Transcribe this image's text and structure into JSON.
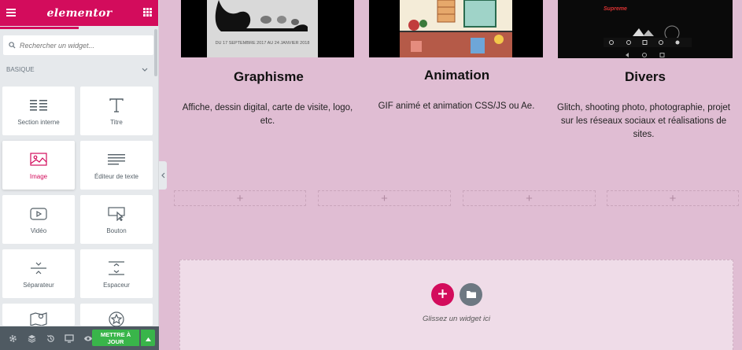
{
  "panel": {
    "brand": "elementor",
    "search_placeholder": "Rechercher un widget...",
    "category": "BASIQUE",
    "widgets": [
      {
        "label": "Section interne",
        "icon": "columns-icon"
      },
      {
        "label": "Titre",
        "icon": "heading-icon"
      },
      {
        "label": "Image",
        "icon": "image-icon"
      },
      {
        "label": "Éditeur de texte",
        "icon": "text-editor-icon"
      },
      {
        "label": "Vidéo",
        "icon": "video-icon"
      },
      {
        "label": "Bouton",
        "icon": "button-icon"
      },
      {
        "label": "Séparateur",
        "icon": "divider-icon"
      },
      {
        "label": "Espaceur",
        "icon": "spacer-icon"
      }
    ],
    "publish_label_1": "METTRE À",
    "publish_label_2": "JOUR"
  },
  "columns": [
    {
      "title": "Graphisme",
      "description": "Affiche, dessin digital, carte de visite, logo, etc.",
      "image_caption": "DU 17 SEPTEMBRE 2017 AU 24 JANVIER 2018"
    },
    {
      "title": "Animation",
      "description": "GIF animé et animation CSS/JS ou Ae."
    },
    {
      "title": "Divers",
      "description": "Glitch, shooting photo, photographie, projet sur les réseaux sociaux et réalisations de sites.",
      "image_caption": "Supreme"
    }
  ],
  "dropzone": {
    "label": "Glissez un widget ici"
  },
  "colors": {
    "accent": "#d30c5c",
    "canvas_bg": "#e0bdd3",
    "panel_bg": "#e6e9ec",
    "publish": "#39b54a"
  }
}
